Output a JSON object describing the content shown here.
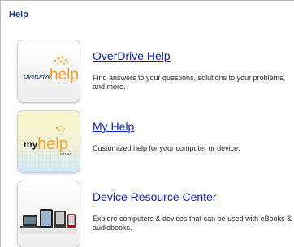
{
  "page": {
    "heading": "Help",
    "colors": {
      "heading": "#1b3a77",
      "link": "#0d1fb8",
      "text": "#222222"
    }
  },
  "items": [
    {
      "title": "OverDrive Help",
      "description": "Find answers to your questions, solutions to your problems, and more.",
      "logo_text_1": "OverDrive",
      "logo_text_2": "help",
      "icon": "overdrive-help-icon"
    },
    {
      "title": "My Help",
      "description": "Customized help for your computer or device.",
      "logo_text_1": "my",
      "logo_text_2": "help",
      "logo_text_3": "wizard",
      "icon": "my-help-icon"
    },
    {
      "title": "Device Resource Center",
      "description": "Explore computers & devices that can be used with eBooks & audiobooks.",
      "icon": "device-resource-center-icon"
    }
  ]
}
